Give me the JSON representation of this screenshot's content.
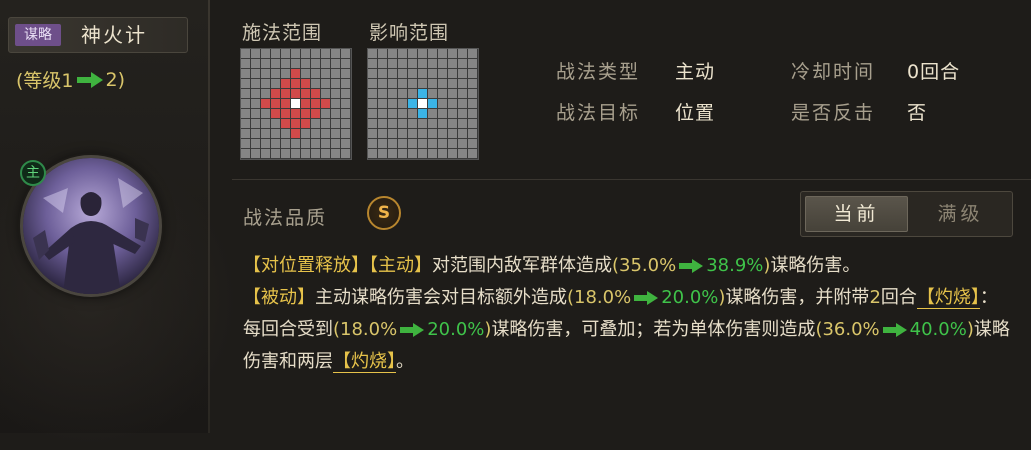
{
  "skill": {
    "type_tag": "谋略",
    "name": "神火计",
    "level_open": "(等级1",
    "level_close": "2)",
    "main_badge": "主"
  },
  "range": {
    "cast_label": "施法范围",
    "effect_label": "影响范围"
  },
  "info": {
    "type_label": "战法类型",
    "type_value": "主动",
    "cooldown_label": "冷却时间",
    "cooldown_value": "0回合",
    "target_label": "战法目标",
    "target_value": "位置",
    "counter_label": "是否反击",
    "counter_value": "否"
  },
  "quality": {
    "label": "战法品质",
    "grade": "S"
  },
  "toggle": {
    "current": "当前",
    "max": "满级"
  },
  "desc": {
    "p1_tag1": "【对位置释放】",
    "p1_tag2": "【主动】",
    "p1_text": "对范围内敌军群体造成",
    "p1_v1": "(35.0%",
    "p1_v2": "38.9%",
    "p1_close": ")",
    "p1_tail": "谋略伤害。",
    "p2_tag": "【被动】",
    "p2_text": "主动谋略伤害会对目标额外造成",
    "p2_v1": "(18.0%",
    "p2_v2": "20.0%",
    "p2_close": ")",
    "p2_mid": "谋略伤害，并附带",
    "p2_rounds": "2",
    "p2_rounds_unit": "回合",
    "p2_burn": "【灼烧】",
    "p2_text2": "：每回合受到",
    "p2_v3": "(18.0%",
    "p2_v4": "20.0%",
    "p2_close2": ")",
    "p2_text3": "谋略伤害，可叠加；若为单体伤害则造成",
    "p2_v5": "(36.0%",
    "p2_v6": "40.0%",
    "p2_close3": ")",
    "p2_text4": "谋略伤害和两层",
    "p2_burn2": "【灼烧】",
    "p2_end": "。"
  },
  "colors": {
    "tag_purple": "#6e4f8a",
    "cast_red": "#d04a4a",
    "effect_blue": "#3bb4e6",
    "value_green": "#3fc34a",
    "value_yellow": "#d9c56a",
    "quality_gold": "#f0b44a"
  }
}
